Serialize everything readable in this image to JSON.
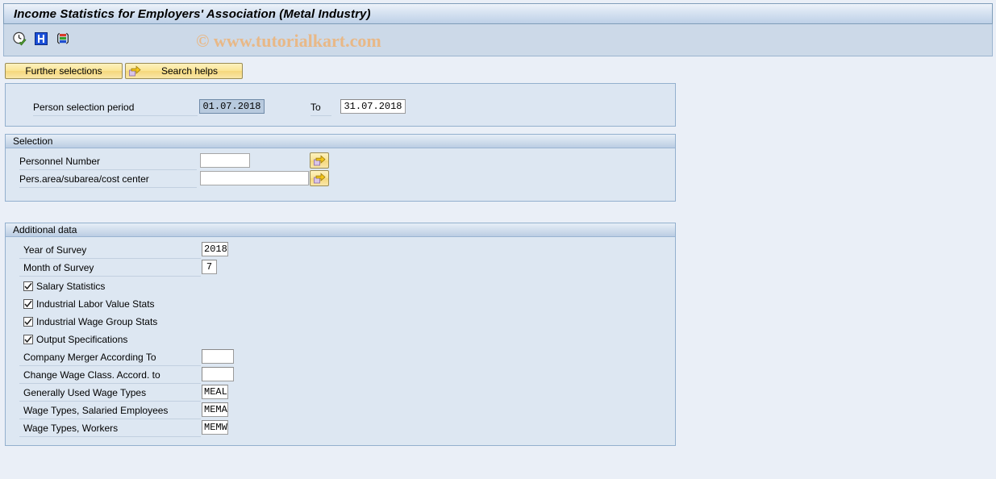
{
  "window": {
    "title": "Income Statistics for Employers' Association (Metal Industry)"
  },
  "toolbar": {
    "icons": [
      {
        "name": "execute-clock-icon",
        "title": "Execute"
      },
      {
        "name": "information-icon",
        "title": "Information"
      },
      {
        "name": "variant-icon",
        "title": "Get Variant"
      }
    ]
  },
  "watermark": {
    "text": "© www.tutorialkart.com"
  },
  "buttons": {
    "further_selections": "Further selections",
    "search_helps": "Search helps"
  },
  "period": {
    "label": "Person selection period",
    "from_value": "01.07.2018",
    "to_label": "To",
    "to_value": "31.07.2018"
  },
  "selection": {
    "header": "Selection",
    "rows": [
      {
        "label": "Personnel Number",
        "value": "",
        "placeholder": ""
      },
      {
        "label": "Pers.area/subarea/cost center",
        "value": "",
        "placeholder": ""
      }
    ]
  },
  "additional": {
    "header": "Additional data",
    "fields": [
      {
        "label": "Year of Survey",
        "value": "2018"
      },
      {
        "label": "Month of Survey",
        "value": "7"
      }
    ],
    "checkboxes": [
      {
        "label": "Salary Statistics",
        "checked": true
      },
      {
        "label": "Industrial Labor Value Stats",
        "checked": true
      },
      {
        "label": "Industrial Wage Group Stats",
        "checked": true
      },
      {
        "label": "Output Specifications",
        "checked": true
      }
    ],
    "text_fields": [
      {
        "label": "Company Merger According To",
        "value": ""
      },
      {
        "label": "Change Wage Class. Accord. to",
        "value": ""
      },
      {
        "label": "Generally Used Wage Types",
        "value": "MEAL"
      },
      {
        "label": "Wage Types, Salaried Employees",
        "value": "MEMA"
      },
      {
        "label": "Wage Types, Workers",
        "value": "MEMW"
      }
    ]
  },
  "colors": {
    "background": "#eaeff7",
    "panel": "#dde7f2",
    "title_bar": "#bdd0e7",
    "toolbar": "#ccd9e8",
    "button_yellow": "#fae596",
    "watermark": "#e8b887",
    "selected_field": "#b8cade"
  }
}
